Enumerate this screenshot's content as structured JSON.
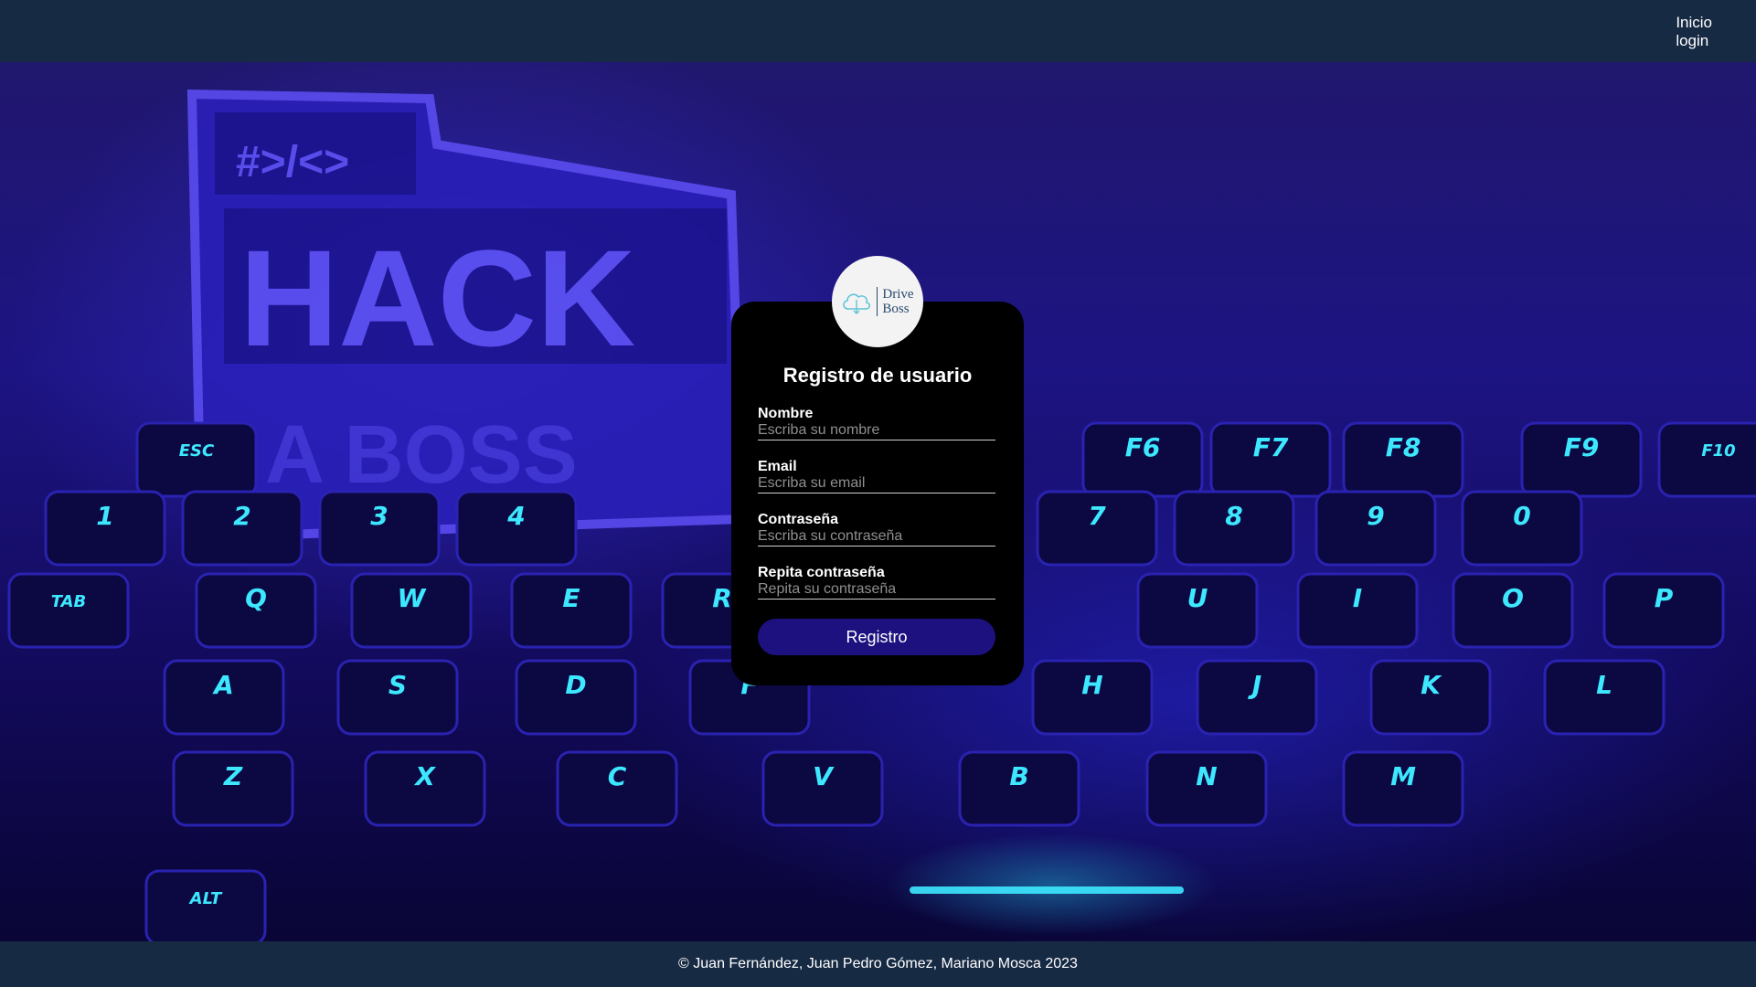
{
  "nav": {
    "items": [
      "Inicio",
      "login"
    ]
  },
  "background": {
    "sticker_tag": "#>/<>",
    "sticker_word": "HACK",
    "sticker_word2": "A BOSS",
    "keys": [
      "ESC",
      "F6",
      "F7",
      "F8",
      "F9",
      "F10",
      "1",
      "2",
      "3",
      "4",
      "7",
      "8",
      "9",
      "0",
      "TAB",
      "Q",
      "W",
      "E",
      "R",
      "U",
      "I",
      "O",
      "P",
      "A",
      "S",
      "D",
      "F",
      "H",
      "J",
      "K",
      "L",
      "Z",
      "X",
      "C",
      "V",
      "B",
      "N",
      "M",
      "ALT"
    ]
  },
  "logo": {
    "line1": "Drive",
    "line2": "Boss"
  },
  "form": {
    "title": "Registro de usuario",
    "fields": [
      {
        "label": "Nombre",
        "placeholder": "Escriba su nombre"
      },
      {
        "label": "Email",
        "placeholder": "Escriba su email"
      },
      {
        "label": "Contraseña",
        "placeholder": "Escriba su contraseña"
      },
      {
        "label": "Repita contraseña",
        "placeholder": "Repita su contraseña"
      }
    ],
    "submit_label": "Registro"
  },
  "footer": {
    "text": "© Juan Fernández, Juan Pedro Gómez, Mariano Mosca 2023"
  },
  "colors": {
    "header": "#172a44",
    "card": "#000000",
    "button": "#1d1180",
    "key_glow": "#3de8ff"
  }
}
